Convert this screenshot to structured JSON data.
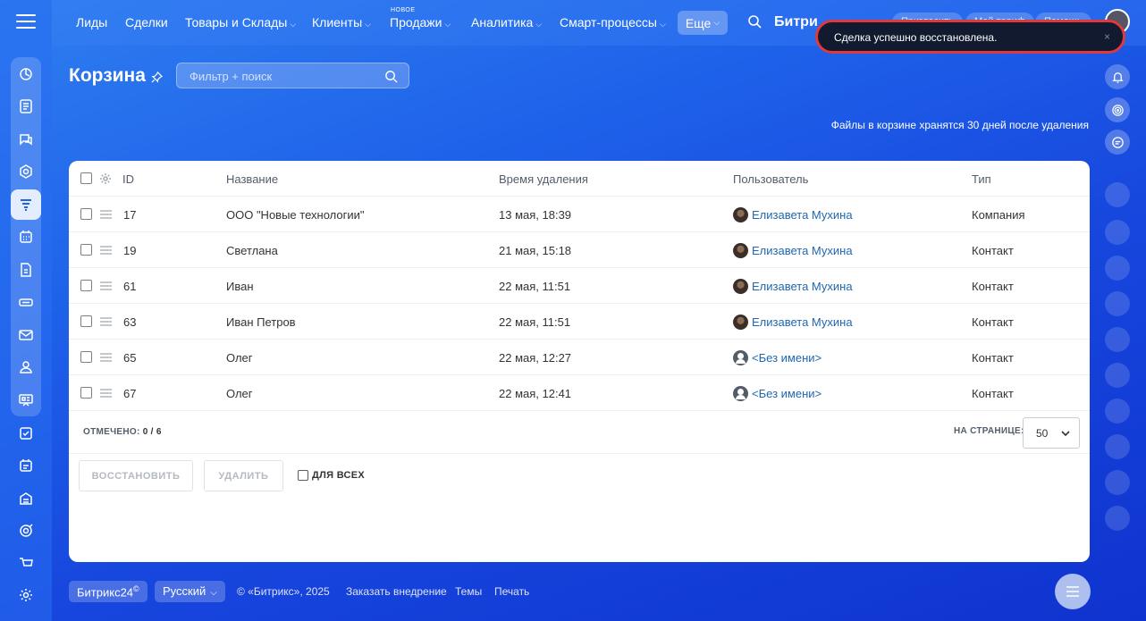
{
  "topnav": {
    "items": [
      {
        "label": "Лиды",
        "dropdown": false
      },
      {
        "label": "Сделки",
        "dropdown": false
      },
      {
        "label": "Товары и Склады",
        "dropdown": true
      },
      {
        "label": "Клиенты",
        "dropdown": true
      },
      {
        "label": "Продажи",
        "dropdown": true
      },
      {
        "label": "Аналитика",
        "dropdown": true
      },
      {
        "label": "Смарт-процессы",
        "dropdown": true
      }
    ],
    "new_badge": "НОВОЕ",
    "more_label": "Еще",
    "brand": "Битри",
    "ghost_buttons": [
      "Пригласить",
      "Мой тариф",
      "Помощь"
    ]
  },
  "toast": {
    "message": "Сделка успешно восстановлена.",
    "close_glyph": "×"
  },
  "header": {
    "title": "Корзина",
    "filter_placeholder": "Фильтр + поиск",
    "retention_note": "Файлы в корзине хранятся 30 дней после удаления"
  },
  "table": {
    "columns": {
      "id": "ID",
      "name": "Название",
      "deleted_at": "Время удаления",
      "user": "Пользователь",
      "type": "Тип"
    },
    "rows": [
      {
        "id": "17",
        "name": "ООО \"Новые технологии\"",
        "deleted_at": "13 мая, 18:39",
        "user": "Елизавета Мухина",
        "avatar": "photo",
        "type": "Компания"
      },
      {
        "id": "19",
        "name": "Светлана",
        "deleted_at": "21 мая, 15:18",
        "user": "Елизавета Мухина",
        "avatar": "photo",
        "type": "Контакт"
      },
      {
        "id": "61",
        "name": "Иван",
        "deleted_at": "22 мая, 11:51",
        "user": "Елизавета Мухина",
        "avatar": "photo",
        "type": "Контакт"
      },
      {
        "id": "63",
        "name": "Иван Петров",
        "deleted_at": "22 мая, 11:51",
        "user": "Елизавета Мухина",
        "avatar": "photo",
        "type": "Контакт"
      },
      {
        "id": "65",
        "name": "Олег",
        "deleted_at": "22 мая, 12:27",
        "user": "<Без имени>",
        "avatar": "blank",
        "type": "Контакт"
      },
      {
        "id": "67",
        "name": "Олег",
        "deleted_at": "22 мая, 12:41",
        "user": "<Без имени>",
        "avatar": "blank",
        "type": "Контакт"
      }
    ],
    "selected_label": "ОТМЕЧЕНО:",
    "selected_value": "0 / 6",
    "per_page_label": "НА СТРАНИЦЕ:",
    "per_page_value": "50"
  },
  "actions": {
    "restore": "ВОССТАНОВИТЬ",
    "delete": "УДАЛИТЬ",
    "for_all": "ДЛЯ ВСЕХ"
  },
  "footer": {
    "brand": "Битрикс24",
    "brand_mark": "©",
    "language": "Русский",
    "copyright": "© «Битрикс», 2025",
    "links": [
      "Заказать внедрение",
      "Темы",
      "Печать"
    ]
  },
  "icons": {
    "left_rail": [
      "funnel-flow-icon",
      "document-list-icon",
      "chat-icon",
      "hexagon-icon",
      "crm-funnel-icon",
      "calendar-icon",
      "file-icon",
      "drive-icon",
      "mail-icon",
      "contacts-icon",
      "presentation-icon",
      "task-check-icon",
      "planner-icon",
      "store-icon",
      "target-icon",
      "cart-icon",
      "settings-icon"
    ],
    "right_rail": [
      "bell-icon",
      "fingerprint-icon",
      "chat-bubble-icon"
    ]
  },
  "colors": {
    "accent_link": "#2067b0",
    "toast_border": "#e0393c",
    "toast_bg": "#111a2e"
  }
}
